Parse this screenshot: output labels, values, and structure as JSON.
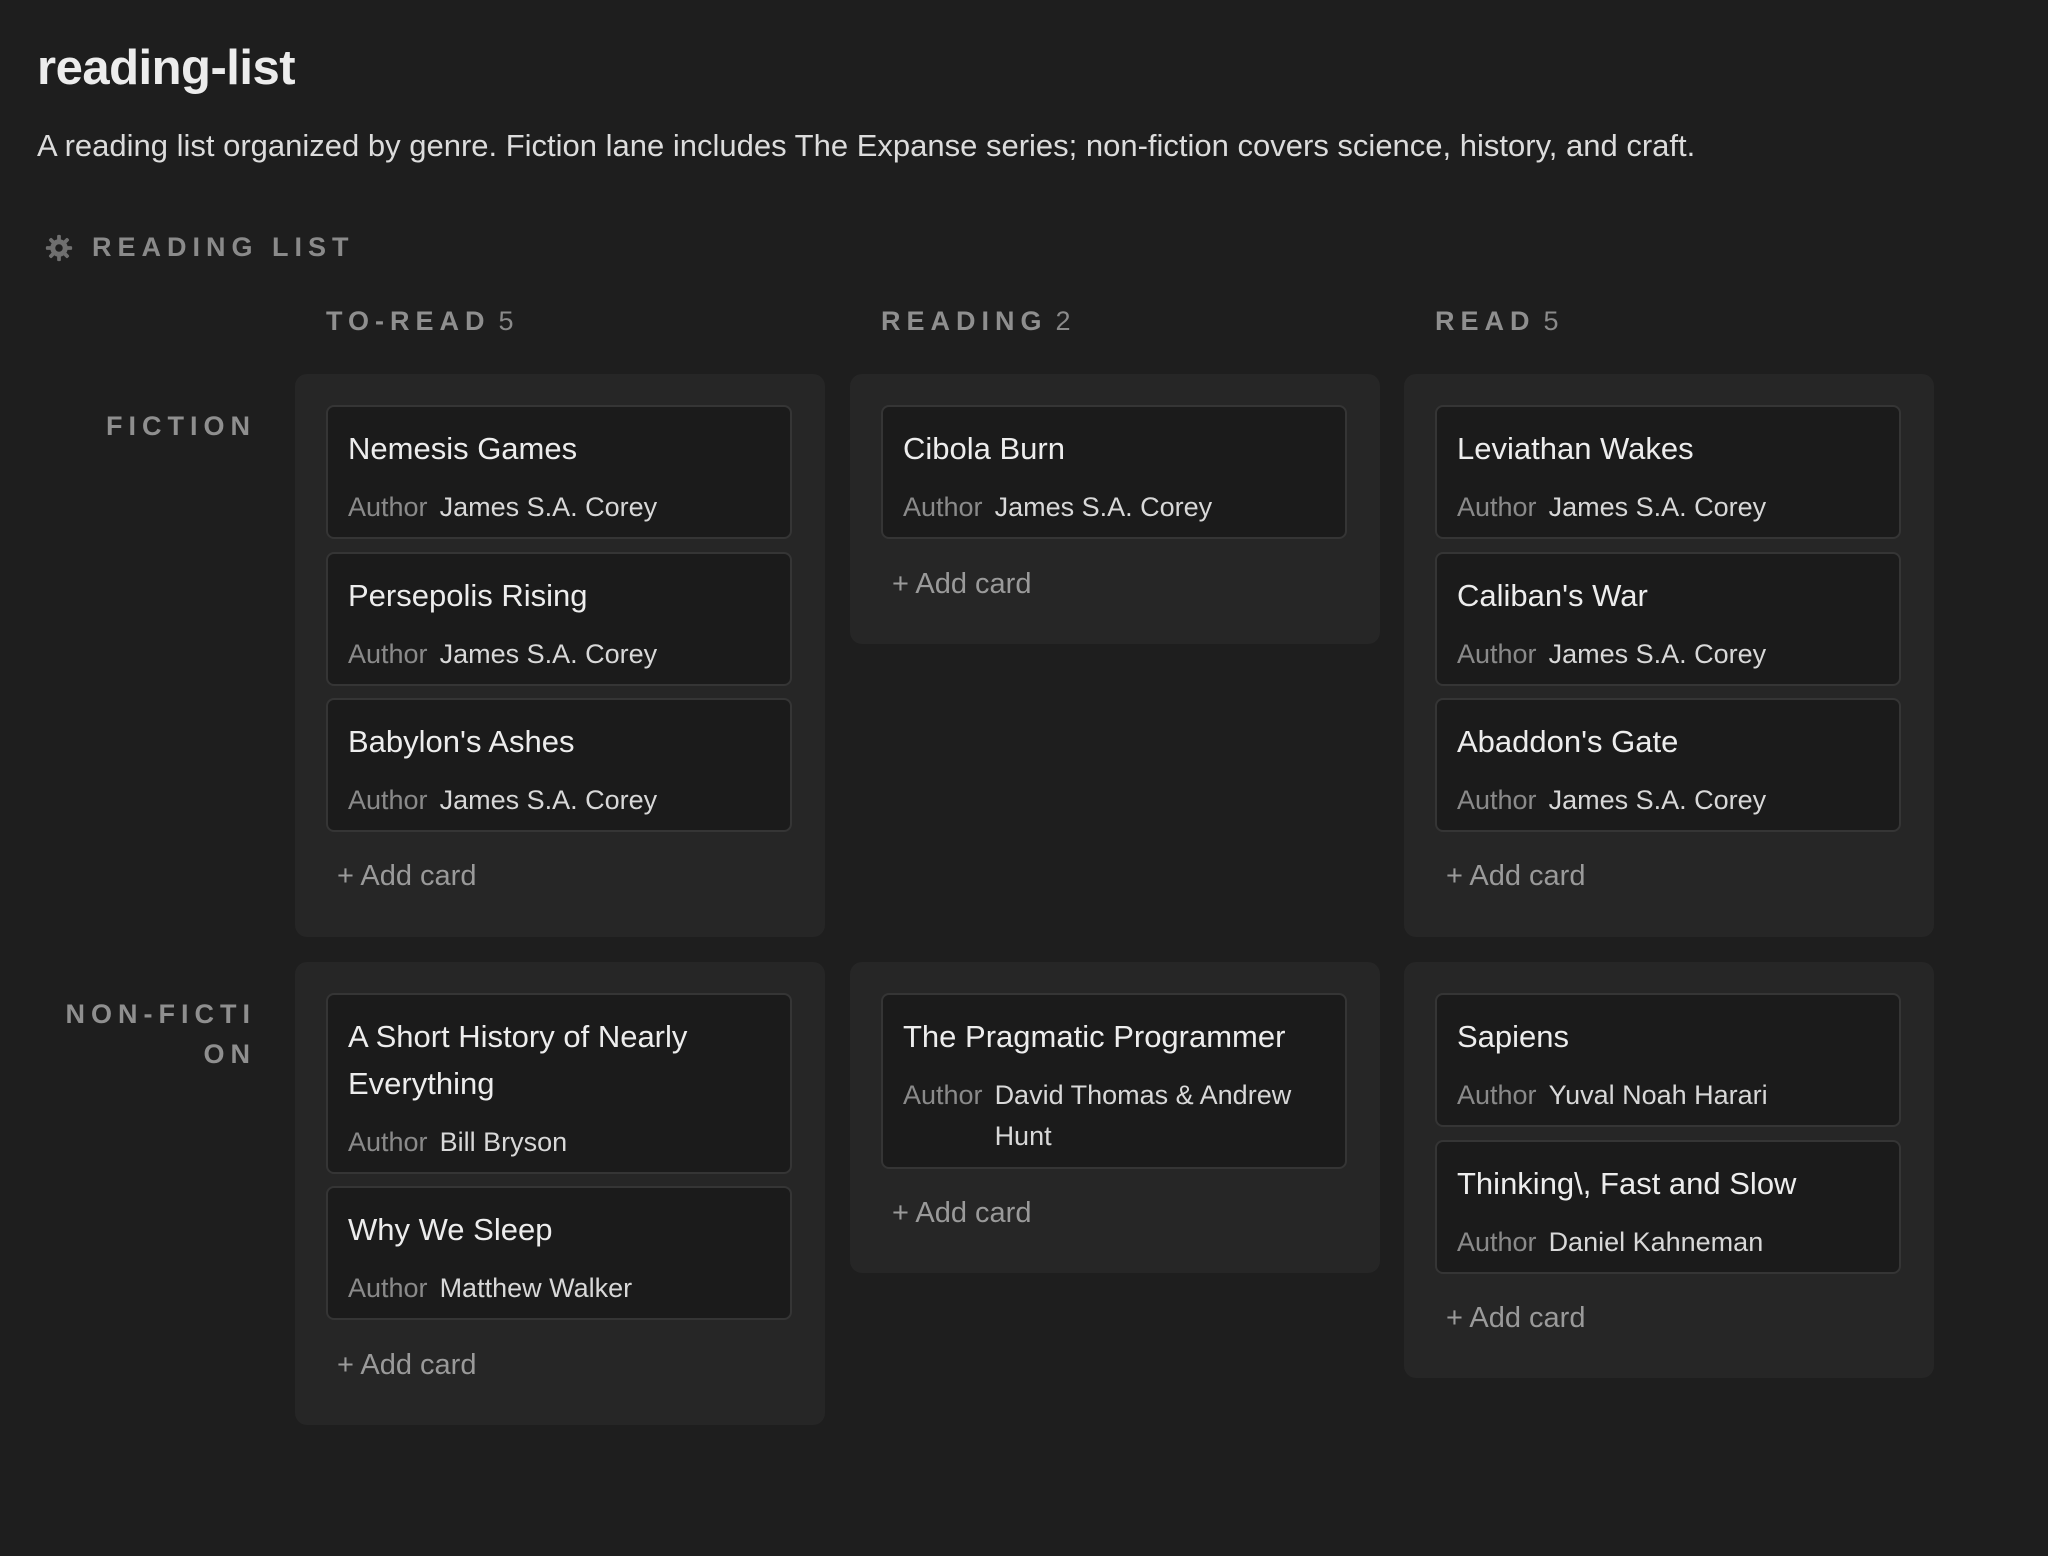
{
  "page": {
    "title": "reading-list",
    "description": "A reading list organized by genre. Fiction lane includes The Expanse series; non-fiction covers science, history, and craft."
  },
  "board": {
    "label": "READING LIST",
    "icon": "gear-icon",
    "add_card_label": "+ Add card",
    "columns": [
      {
        "name": "TO-READ",
        "count": "5"
      },
      {
        "name": "READING",
        "count": "2"
      },
      {
        "name": "READ",
        "count": "5"
      }
    ],
    "rows": [
      {
        "name": "FICTION"
      },
      {
        "name": "NON-FICTION"
      }
    ],
    "cards": {
      "fiction_to_read": [
        {
          "title": "Nemesis Games",
          "key": "Author",
          "author": "James S.A. Corey"
        },
        {
          "title": "Persepolis Rising",
          "key": "Author",
          "author": "James S.A. Corey"
        },
        {
          "title": "Babylon's Ashes",
          "key": "Author",
          "author": "James S.A. Corey"
        }
      ],
      "fiction_reading": [
        {
          "title": "Cibola Burn",
          "key": "Author",
          "author": "James S.A. Corey"
        }
      ],
      "fiction_read": [
        {
          "title": "Leviathan Wakes",
          "key": "Author",
          "author": "James S.A. Corey"
        },
        {
          "title": "Caliban's War",
          "key": "Author",
          "author": "James S.A. Corey"
        },
        {
          "title": "Abaddon's Gate",
          "key": "Author",
          "author": "James S.A. Corey"
        }
      ],
      "nonfiction_to_read": [
        {
          "title": "A Short History of Nearly Everything",
          "key": "Author",
          "author": "Bill Bryson"
        },
        {
          "title": "Why We Sleep",
          "key": "Author",
          "author": "Matthew Walker"
        }
      ],
      "nonfiction_reading": [
        {
          "title": "The Pragmatic Programmer",
          "key": "Author",
          "author": "David Thomas & Andrew Hunt"
        }
      ],
      "nonfiction_read": [
        {
          "title": "Sapiens",
          "key": "Author",
          "author": "Yuval Noah Harari"
        },
        {
          "title": "Thinking\\, Fast and Slow",
          "key": "Author",
          "author": "Daniel Kahneman"
        }
      ]
    }
  }
}
